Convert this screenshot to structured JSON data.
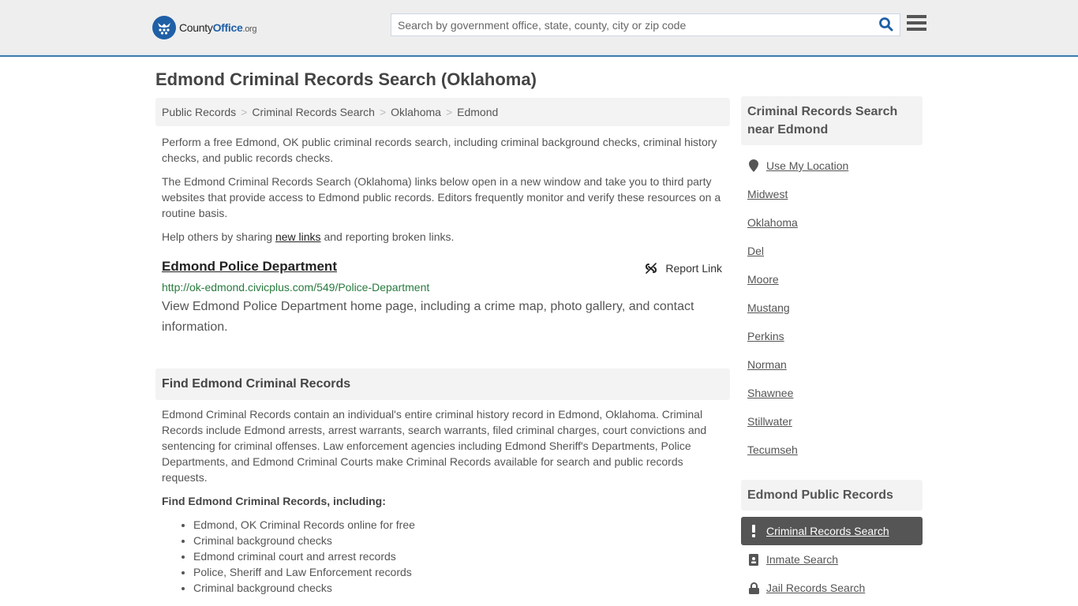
{
  "header": {
    "logo": {
      "name": "County",
      "name_accent": "Office",
      "tld": ".org"
    },
    "search": {
      "placeholder": "Search by government office, state, county, city or zip code",
      "value": ""
    },
    "colors": {
      "brand": "#1f5fa6",
      "header_border": "#3a7cad"
    }
  },
  "page": {
    "title": "Edmond Criminal Records Search (Oklahoma)",
    "breadcrumb": [
      "Public Records",
      "Criminal Records Search",
      "Oklahoma",
      "Edmond"
    ],
    "intro": [
      "Perform a free Edmond, OK public criminal records search, including criminal background checks, criminal history checks, and public records checks.",
      "The Edmond Criminal Records Search (Oklahoma) links below open in a new window and take you to third party websites that provide access to Edmond public records. Editors frequently monitor and verify these resources on a routine basis."
    ],
    "help": {
      "before": "Help others by sharing ",
      "link": "new links",
      "after": " and reporting broken links."
    }
  },
  "resource": {
    "title": "Edmond Police Department",
    "report_label": "Report Link",
    "url": "http://ok-edmond.civicplus.com/549/Police-Department",
    "description": "View Edmond Police Department home page, including a crime map, photo gallery, and contact information."
  },
  "find": {
    "heading": "Find Edmond Criminal Records",
    "body": "Edmond Criminal Records contain an individual's entire criminal history record in Edmond, Oklahoma. Criminal Records include Edmond arrests, arrest warrants, search warrants, filed criminal charges, court convictions and sentencing for criminal offenses. Law enforcement agencies including Edmond Sheriff's Departments, Police Departments, and Edmond Criminal Courts make Criminal Records available for search and public records requests.",
    "subheading": "Find Edmond Criminal Records, including:",
    "items": [
      "Edmond, OK Criminal Records online for free",
      "Criminal background checks",
      "Edmond criminal court and arrest records",
      "Police, Sheriff and Law Enforcement records",
      "Criminal background checks"
    ]
  },
  "sidebar": {
    "nearby": {
      "heading": "Criminal Records Search near Edmond",
      "use_location": "Use My Location",
      "places": [
        "Midwest",
        "Oklahoma",
        "Del",
        "Moore",
        "Mustang",
        "Perkins",
        "Norman",
        "Shawnee",
        "Stillwater",
        "Tecumseh"
      ]
    },
    "public_records": {
      "heading": "Edmond Public Records",
      "items": [
        {
          "label": "Criminal Records Search",
          "icon": "exclamation-icon",
          "active": true
        },
        {
          "label": "Inmate Search",
          "icon": "id-badge-icon",
          "active": false
        },
        {
          "label": "Jail Records Search",
          "icon": "lock-icon",
          "active": false
        }
      ]
    }
  }
}
